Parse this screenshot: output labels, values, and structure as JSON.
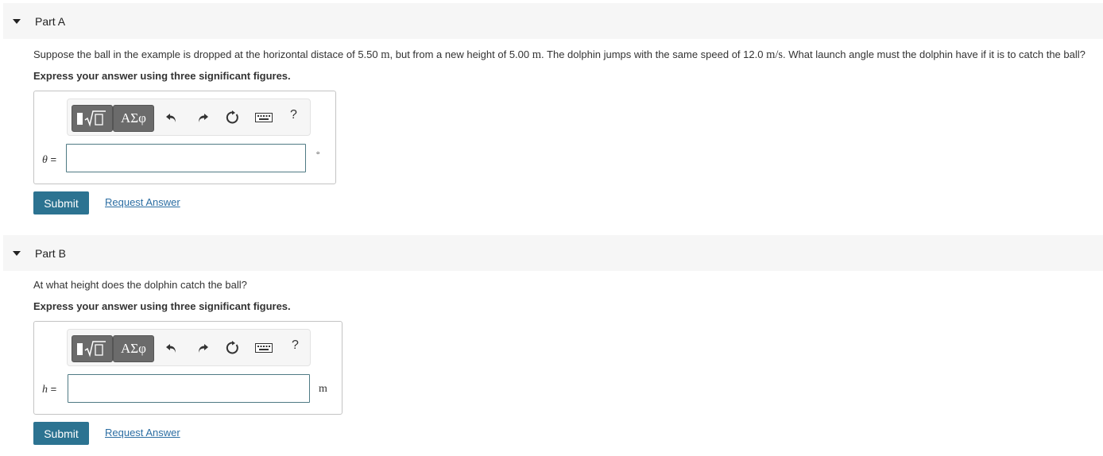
{
  "parts": [
    {
      "header": "Part A",
      "question": {
        "seg1": "Suppose the ball in the example is dropped at the horizontal distace of 5.50 ",
        "unit1": "m",
        "seg2": ", but from a new height of 5.00 ",
        "unit2": "m",
        "seg3": ". The dolphin jumps with the same speed of 12.0 ",
        "unit3": "m/s",
        "seg4": ". What launch angle must the dolphin have if it is to catch the ball?"
      },
      "instruction": "Express your answer using three significant figures.",
      "variable": "θ",
      "equals": " =",
      "answer_value": "",
      "unit": "°",
      "submit_label": "Submit",
      "request_label": "Request Answer"
    },
    {
      "header": "Part B",
      "question": {
        "seg1": "At what height does the dolphin catch the ball?"
      },
      "instruction": "Express your answer using three significant figures.",
      "variable": "h",
      "equals": " =",
      "answer_value": "",
      "unit": "m",
      "submit_label": "Submit",
      "request_label": "Request Answer"
    }
  ],
  "toolbar": {
    "symbols_label": "ΑΣφ",
    "help_label": "?",
    "icons": [
      "templates-icon",
      "undo-icon",
      "redo-icon",
      "reset-icon",
      "keyboard-icon",
      "help-icon"
    ]
  },
  "colors": {
    "accent": "#2c7391",
    "link": "#2c6ea3",
    "header_bg": "#f6f6f6",
    "input_border": "#4f7a84"
  }
}
